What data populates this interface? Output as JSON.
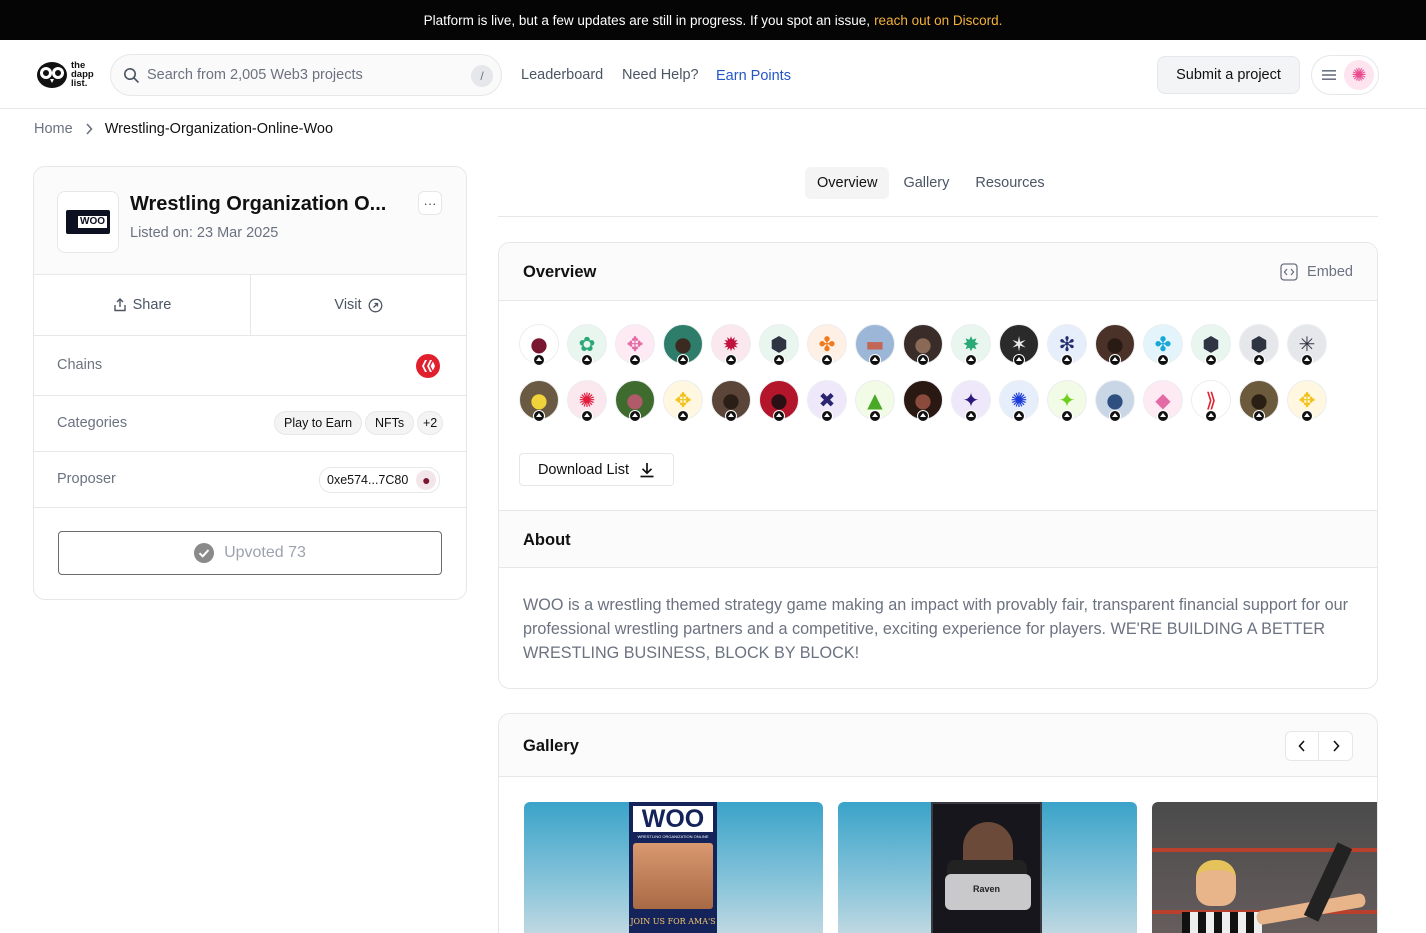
{
  "banner": {
    "text": "Platform is live, but a few updates are still in progress. If you spot an issue,",
    "link": "reach out on Discord."
  },
  "logo": {
    "line1": "the",
    "line2": "dapp",
    "line3": "list."
  },
  "search": {
    "placeholder": "Search from 2,005 Web3 projects",
    "shortcut": "/"
  },
  "nav": {
    "leaderboard": "Leaderboard",
    "help": "Need Help?",
    "earn": "Earn Points",
    "submit": "Submit a project"
  },
  "breadcrumb": {
    "home": "Home",
    "current": "Wrestling-Organization-Online-Woo"
  },
  "project": {
    "logo_text": "WOO",
    "title": "Wrestling Organization O...",
    "listed": "Listed on: 23 Mar 2025",
    "more": "···",
    "share": "Share",
    "visit": "Visit",
    "chains_label": "Chains",
    "categories_label": "Categories",
    "categories": [
      "Play to Earn",
      "NFTs",
      "+2"
    ],
    "proposer_label": "Proposer",
    "proposer": "0xe574...7C80",
    "upvote": "Upvoted 73"
  },
  "tabs": [
    "Overview",
    "Gallery",
    "Resources"
  ],
  "overview": {
    "title": "Overview",
    "embed": "Embed",
    "download": "Download List",
    "upvoter_avatars": [
      {
        "bg": "#ffffff",
        "fg": "#7a1730",
        "glyph": "●"
      },
      {
        "bg": "#e8f6ef",
        "fg": "#2aa876",
        "glyph": "✿"
      },
      {
        "bg": "#fdeaf3",
        "fg": "#e36aa5",
        "glyph": "✥"
      },
      {
        "bg": "#2e7d6b",
        "fg": "#3b2a20",
        "glyph": "●"
      },
      {
        "bg": "#fbe8ee",
        "fg": "#c0123d",
        "glyph": "✹"
      },
      {
        "bg": "#e8f6ef",
        "fg": "#2f3442",
        "glyph": "⬢"
      },
      {
        "bg": "#fff0e6",
        "fg": "#f07a1f",
        "glyph": "✤"
      },
      {
        "bg": "#9bb6d6",
        "fg": "#c26656",
        "glyph": "▬"
      },
      {
        "bg": "#3a2d29",
        "fg": "#8a6a56",
        "glyph": "●"
      },
      {
        "bg": "#e8f6ef",
        "fg": "#2aa876",
        "glyph": "✸"
      },
      {
        "bg": "#2a2a2a",
        "fg": "#e9e9e9",
        "glyph": "✶"
      },
      {
        "bg": "#e7eefb",
        "fg": "#24306b",
        "glyph": "✻"
      },
      {
        "bg": "#4a3228",
        "fg": "#2a1a14",
        "glyph": "●"
      },
      {
        "bg": "#e3f5fb",
        "fg": "#1aa7d8",
        "glyph": "✤"
      },
      {
        "bg": "#e8f6ef",
        "fg": "#2f3442",
        "glyph": "⬢"
      },
      {
        "bg": "#e5e7eb",
        "fg": "#2f3442",
        "glyph": "⬢"
      },
      {
        "bg": "#e5e7eb",
        "fg": "#2f3442",
        "glyph": "✳"
      },
      {
        "bg": "#6a5a44",
        "fg": "#f0d23a",
        "glyph": "●"
      },
      {
        "bg": "#fbe8ee",
        "fg": "#e01b3c",
        "glyph": "✺"
      },
      {
        "bg": "#3f6b2f",
        "fg": "#b05a6a",
        "glyph": "●"
      },
      {
        "bg": "#fff7e0",
        "fg": "#f3c21a",
        "glyph": "✥"
      },
      {
        "bg": "#5a4538",
        "fg": "#2a1e16",
        "glyph": "●"
      },
      {
        "bg": "#b3162a",
        "fg": "#2a1014",
        "glyph": "●"
      },
      {
        "bg": "#efe8fb",
        "fg": "#2a2470",
        "glyph": "✖"
      },
      {
        "bg": "#f1fbe6",
        "fg": "#4aa827",
        "glyph": "▲"
      },
      {
        "bg": "#2a1812",
        "fg": "#8a4a3c",
        "glyph": "●"
      },
      {
        "bg": "#efe8fb",
        "fg": "#2a1a80",
        "glyph": "✦"
      },
      {
        "bg": "#e7eefb",
        "fg": "#1b3ad8",
        "glyph": "✺"
      },
      {
        "bg": "#f1fbe6",
        "fg": "#6fcf1f",
        "glyph": "✦"
      },
      {
        "bg": "#c9d6e6",
        "fg": "#2f4f80",
        "glyph": "●"
      },
      {
        "bg": "#fdeaf3",
        "fg": "#e36aa5",
        "glyph": "◆"
      },
      {
        "bg": "#ffffff",
        "fg": "#e0202c",
        "glyph": "⟫"
      },
      {
        "bg": "#6b5a3c",
        "fg": "#2a1f14",
        "glyph": "●"
      },
      {
        "bg": "#fff7e0",
        "fg": "#f3c21a",
        "glyph": "✥"
      }
    ]
  },
  "about": {
    "title": "About",
    "text": "WOO is a wrestling themed strategy game making an impact with provably fair, transparent financial support for our professional wrestling partners and a competitive, exciting experience for players. WE'RE BUILDING A BETTER WRESTLING BUSINESS, BLOCK BY BLOCK!"
  },
  "gallery": {
    "title": "Gallery",
    "images": [
      {
        "poster_title": "WOO",
        "poster_sub": "WRESTLING ORGANIZATION ONLINE",
        "poster_foot": "JOIN US FOR AMA'S"
      },
      {
        "card_name": "Raven"
      },
      {
        "alt": "referee"
      }
    ]
  },
  "colors": {
    "accent": "#2457c5",
    "banner_link": "#f5b13a",
    "chain_red": "#e0202c"
  }
}
